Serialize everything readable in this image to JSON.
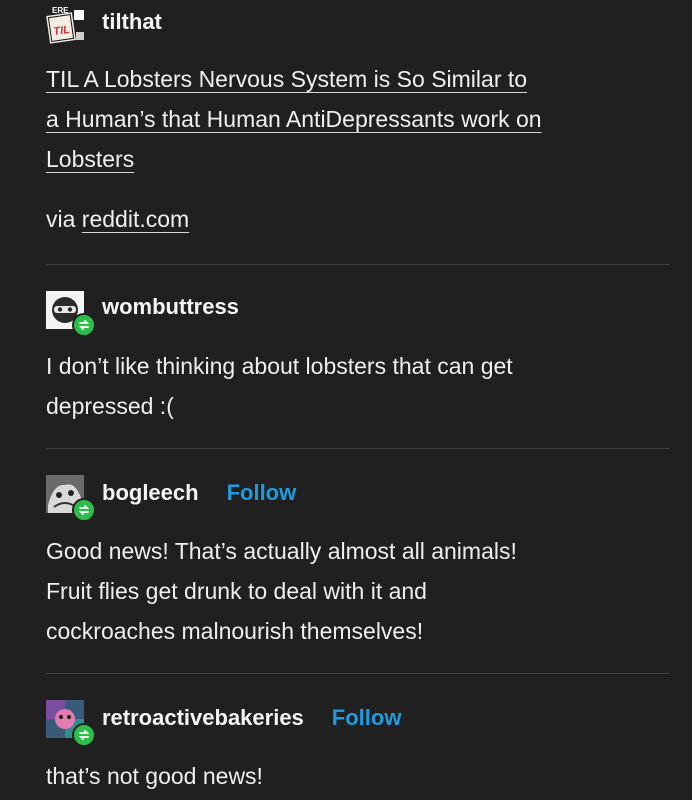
{
  "posts": [
    {
      "username": "tilthat",
      "title": "TIL A Lobsters Nervous System is So Similar to a Human’s that Human AntiDepressants work on Lobsters",
      "title_lines": [
        "TIL A Lobsters Nervous System is So Similar to",
        "a Human’s that Human AntiDepressants work on",
        "Lobsters"
      ],
      "via_prefix": "via ",
      "via_link": "reddit.com",
      "avatar_icon": "til-logo-icon"
    },
    {
      "username": "wombuttress",
      "body_lines": [
        "I don’t like thinking about lobsters that can get",
        "depressed :("
      ],
      "avatar_icon": "helmet-icon",
      "badge_icon": "reblog-icon"
    },
    {
      "username": "bogleech",
      "follow_label": "Follow",
      "body_lines": [
        "Good news! That’s actually almost all animals!",
        "Fruit flies get drunk to deal with it and",
        "cockroaches malnourish themselves!"
      ],
      "avatar_icon": "creature-avatar-icon",
      "badge_icon": "reblog-icon"
    },
    {
      "username": "retroactivebakeries",
      "follow_label": "Follow",
      "body_lines": [
        "that’s not good news!"
      ],
      "avatar_icon": "colorful-avatar-icon",
      "badge_icon": "reblog-icon"
    }
  ],
  "colors": {
    "background": "#202020",
    "text": "#efefef",
    "follow": "#1e9bdf",
    "reblog_badge": "#2dbe4a",
    "divider": "#3d3d3d"
  }
}
